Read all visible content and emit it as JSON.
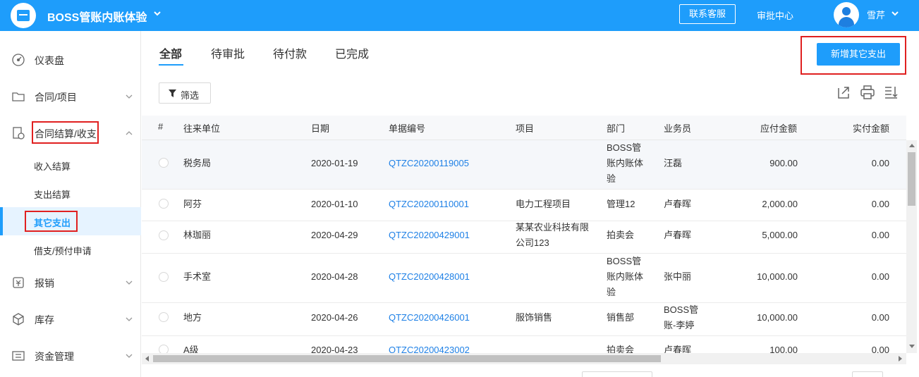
{
  "header": {
    "company_name": "BOSS管账内账体验",
    "contact_label": "联系客服",
    "approval_label": "审批中心",
    "username": "雪芹"
  },
  "sidebar": {
    "items": [
      {
        "label": "仪表盘",
        "icon": "dashboard-icon"
      },
      {
        "label": "合同/项目",
        "icon": "folder-icon"
      },
      {
        "label": "合同结算/收支",
        "icon": "settlement-icon"
      },
      {
        "label": "报销",
        "icon": "reimburse-icon"
      },
      {
        "label": "库存",
        "icon": "box-icon"
      },
      {
        "label": "资金管理",
        "icon": "fund-icon"
      }
    ],
    "subitems": [
      {
        "label": "收入结算"
      },
      {
        "label": "支出结算"
      },
      {
        "label": "其它支出",
        "active": true
      },
      {
        "label": "借支/预付申请"
      }
    ]
  },
  "tabs": [
    {
      "label": "全部",
      "active": true
    },
    {
      "label": "待审批"
    },
    {
      "label": "待付款"
    },
    {
      "label": "已完成"
    }
  ],
  "toolbar": {
    "add_label": "新增其它支出",
    "filter_label": "筛选"
  },
  "table": {
    "columns": [
      "#",
      "往来单位",
      "日期",
      "单据编号",
      "项目",
      "部门",
      "业务员",
      "应付金额",
      "实付金额"
    ],
    "rows": [
      {
        "unit": "税务局",
        "date": "2020-01-19",
        "code": "QTZC20200119005",
        "project": "",
        "dept": [
          "BOSS管",
          "账内账体",
          "验"
        ],
        "staff": [
          "汪磊"
        ],
        "payable": "900.00",
        "paid": "0.00"
      },
      {
        "unit": "阿芬",
        "date": "2020-01-10",
        "code": "QTZC20200110001",
        "project": [
          "电力工程项目"
        ],
        "dept": [
          "管理12"
        ],
        "staff": [
          "卢春晖"
        ],
        "payable": "2,000.00",
        "paid": "0.00"
      },
      {
        "unit": "林珈丽",
        "date": "2020-04-29",
        "code": "QTZC20200429001",
        "project": [
          "某某农业科技有限",
          "公司123"
        ],
        "dept": [
          "拍卖会"
        ],
        "staff": [
          "卢春晖"
        ],
        "payable": "5,000.00",
        "paid": "0.00"
      },
      {
        "unit": "手术室",
        "date": "2020-04-28",
        "code": "QTZC20200428001",
        "project": "",
        "dept": [
          "BOSS管",
          "账内账体",
          "验"
        ],
        "staff": [
          "张中丽"
        ],
        "payable": "10,000.00",
        "paid": "0.00"
      },
      {
        "unit": "地方",
        "date": "2020-04-26",
        "code": "QTZC20200426001",
        "project": [
          "服饰销售"
        ],
        "dept": [
          "销售部"
        ],
        "staff": [
          "BOSS管",
          "账-李婷"
        ],
        "payable": "10,000.00",
        "paid": "0.00"
      },
      {
        "unit": "A级",
        "date": "2020-04-23",
        "code": "QTZC20200423002",
        "project": "",
        "dept": [
          "拍卖会"
        ],
        "staff": [
          "卢春晖"
        ],
        "payable": "100.00",
        "paid": "0.00"
      }
    ]
  }
}
